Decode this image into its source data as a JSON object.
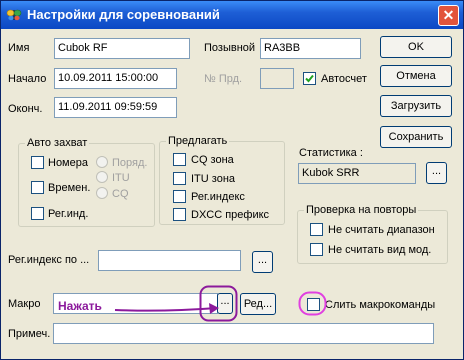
{
  "window": {
    "title": "Настройки для соревнований",
    "close_glyph": "✕"
  },
  "fields": {
    "name_label": "Имя",
    "name_value": "Cubok RF",
    "callsign_label": "Позывной",
    "callsign_value": "RA3BB",
    "start_label": "Начало",
    "start_value": "10.09.2011 15:00:00",
    "end_label": "Оконч.",
    "end_value": "11.09.2011 09:59:59",
    "prd_label": "№ Прд.",
    "prd_value": "",
    "autocount_label": "Автосчет",
    "autocount_checked": true,
    "regindex_label": "Рег.индекс по ...",
    "regindex_value": "",
    "regindex_browse": "...",
    "macro_label": "Макро",
    "macro_value": "",
    "macro_browse": "...",
    "macro_edit": "Ред...",
    "merge_macros_label": "Слить макрокоманды",
    "merge_macros_checked": false,
    "note_label": "Примеч.",
    "note_value": ""
  },
  "buttons": {
    "ok": "OK",
    "cancel": "Отмена",
    "load": "Загрузить",
    "save": "Сохранить"
  },
  "auto_capture": {
    "caption": "Авто захват",
    "numbers_label": "Номера",
    "numbers_checked": false,
    "time_label": "Времен.",
    "time_checked": false,
    "regind_label": "Рег.инд.",
    "regind_checked": false,
    "radio_order": "Поряд.",
    "radio_itu": "ITU",
    "radio_cq": "CQ"
  },
  "suggest": {
    "caption": "Предлагать",
    "items": [
      {
        "label": "CQ зона",
        "checked": false
      },
      {
        "label": "ITU зона",
        "checked": false
      },
      {
        "label": "Рег.индекс",
        "checked": false
      },
      {
        "label": "DXCC префикс",
        "checked": false
      }
    ]
  },
  "statistics": {
    "label": "Статистика :",
    "value": "Kubok SRR",
    "browse": "..."
  },
  "dup_check": {
    "caption": "Проверка на повторы",
    "items": [
      {
        "label": "Не считать диапазон",
        "checked": false
      },
      {
        "label": "Не считать вид мод.",
        "checked": false
      }
    ]
  },
  "annotation": {
    "text": "Нажать",
    "color": "#8c1a9c",
    "highlight_color": "#e040e0"
  }
}
